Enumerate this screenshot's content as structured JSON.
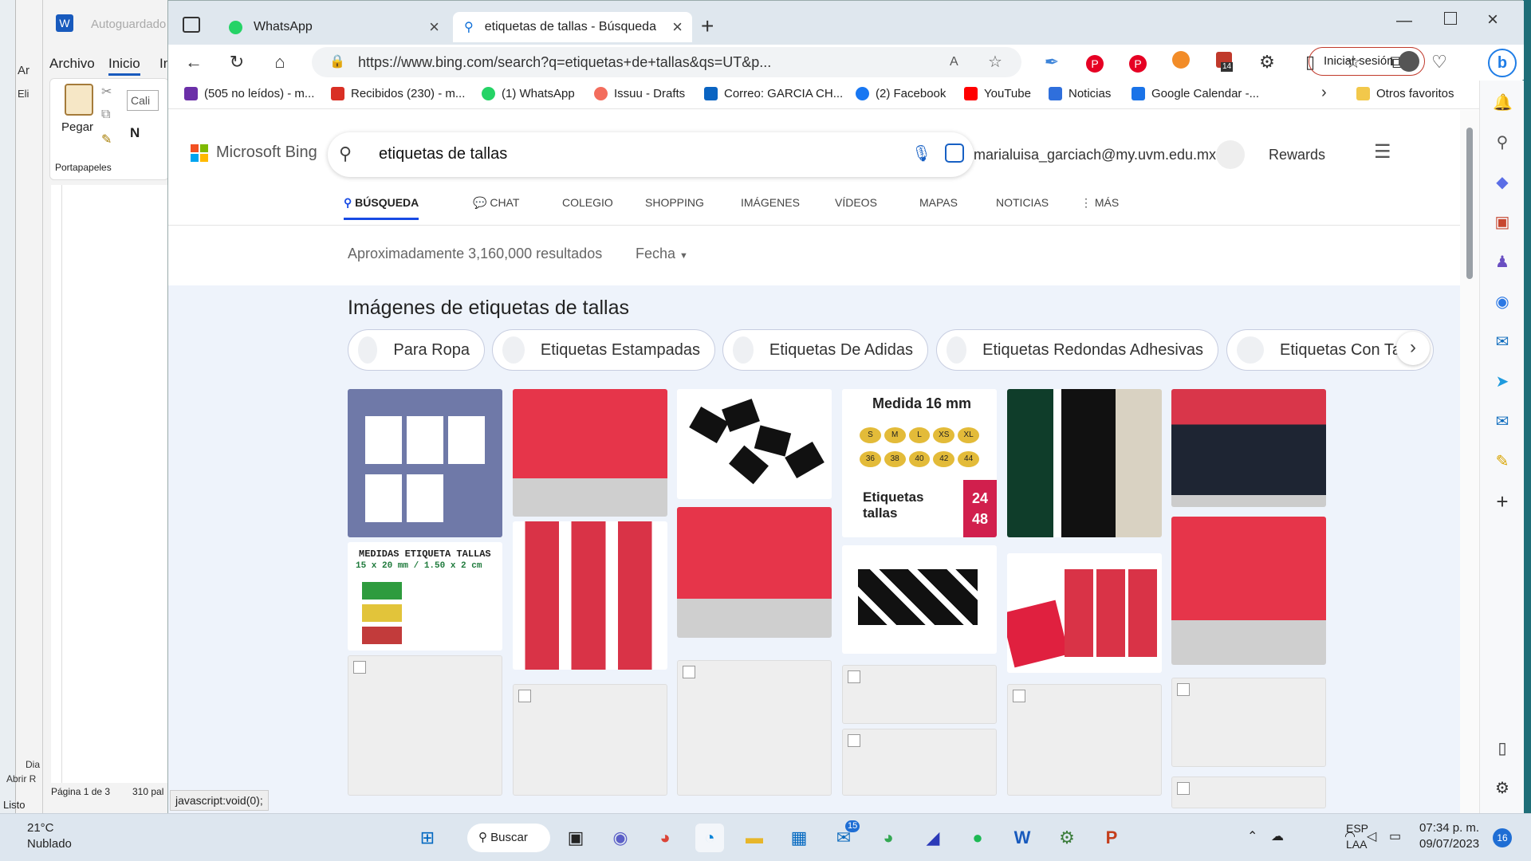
{
  "word": {
    "autosave": "Autoguardado",
    "file_tab": "Archivo",
    "home_tab": "Inicio",
    "home_tab_cut": "In",
    "paste": "Pegar",
    "clipboard": "Portapapeles",
    "font_box": "Cali",
    "bold": "N",
    "page_info": "Página 1 de 3",
    "word_count": "310 pal",
    "status": "Listo",
    "side_text_a": "Ar",
    "side_text_b": "Eli",
    "dia": "Dia",
    "abrir": "Abrir R"
  },
  "browser": {
    "tabs": [
      {
        "label": "WhatsApp"
      },
      {
        "label": "etiquetas de tallas - Búsqueda"
      }
    ],
    "address": "https://www.bing.com/search?q=etiquetas+de+tallas&qs=UT&p...",
    "signin": "Iniciar sesión",
    "badge": "14",
    "favorites": [
      {
        "label": "(505 no leídos) - m...",
        "color": "#6b2fa8"
      },
      {
        "label": "Recibidos (230) - m...",
        "color": "#d93025"
      },
      {
        "label": "(1) WhatsApp",
        "color": "#25d366"
      },
      {
        "label": "Issuu - Drafts",
        "color": "#f36d5d"
      },
      {
        "label": "Correo: GARCIA CH...",
        "color": "#0a64c2"
      },
      {
        "label": "(2) Facebook",
        "color": "#1877f2"
      },
      {
        "label": "YouTube",
        "color": "#ff0000"
      },
      {
        "label": "Noticias",
        "color": "#2f6fdc"
      },
      {
        "label": "Google Calendar -...",
        "color": "#1a73e8"
      }
    ],
    "other_favs": "Otros favoritos",
    "status_link": "javascript:void(0);"
  },
  "bing": {
    "logo": "Microsoft Bing",
    "query": "etiquetas de tallas",
    "account": "marialuisa_garciach@my.uvm.edu.mx",
    "rewards": "Rewards",
    "nav": [
      "BÚSQUEDA",
      "CHAT",
      "COLEGIO",
      "SHOPPING",
      "IMÁGENES",
      "VÍDEOS",
      "MAPAS",
      "NOTICIAS",
      "MÁS"
    ],
    "results": "Aproximadamente 3,160,000 resultados",
    "date_filter": "Fecha",
    "images_title": "Imágenes de etiquetas de tallas",
    "chips": [
      "Para Ropa",
      "Etiquetas Estampadas",
      "Etiquetas De Adidas",
      "Etiquetas Redondas Adhesivas",
      "Etiquetas Con Tall"
    ],
    "thumb_medida": "Medida 16 mm",
    "thumb_etiquetas": "Etiquetas tallas",
    "thumb_sizes": [
      "S",
      "M",
      "L",
      "XS",
      "XL",
      "36",
      "38",
      "40",
      "42",
      "44"
    ],
    "thumb_entrega": "24 48",
    "thumb_medidas_title": "MEDIDAS ETIQUETA TALLAS",
    "thumb_medidas_sub": "15 x 20 mm / 1.50 x 2 cm"
  },
  "taskbar": {
    "temp": "21°C",
    "weather": "Nublado",
    "search": "Buscar",
    "lang1": "ESP",
    "lang2": "LAA",
    "time": "07:34 p. m.",
    "date": "09/07/2023",
    "notif": "16",
    "mail_badge": "15"
  }
}
